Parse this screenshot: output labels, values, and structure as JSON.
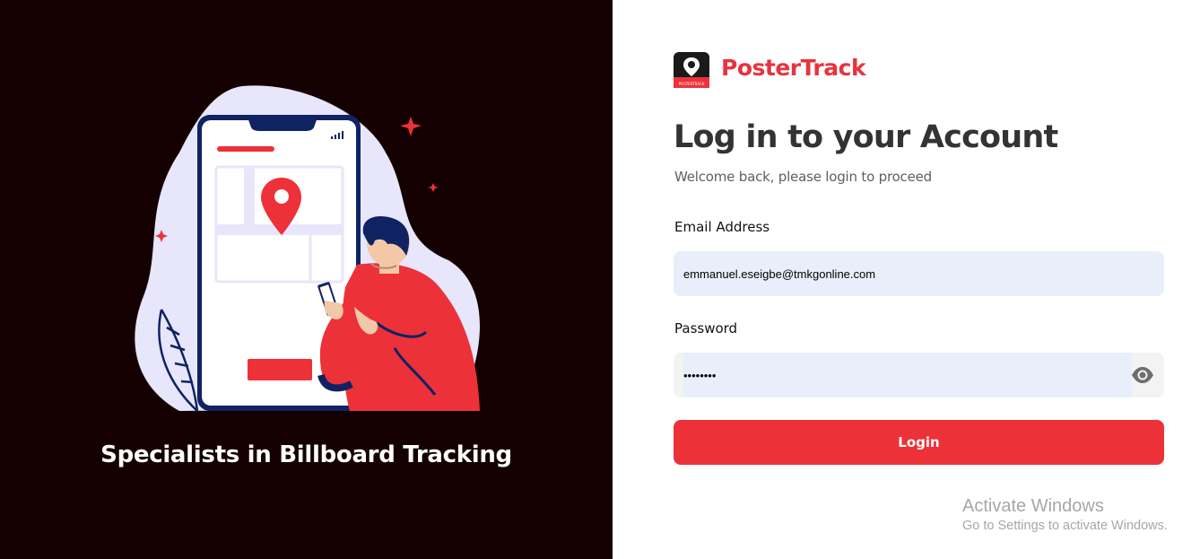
{
  "left": {
    "tagline": "Specialists in Billboard Tracking"
  },
  "brand": {
    "name": "PosterTrack",
    "logo_text": "POSTERTRACK",
    "color": "#e8333d"
  },
  "form": {
    "heading": "Log in to your Account",
    "subtitle": "Welcome back, please login to proceed",
    "email_label": "Email Address",
    "email_value": "emmanuel.eseigbe@tmkgonline.com",
    "password_label": "Password",
    "password_value": "password",
    "login_label": "Login",
    "password_toggle_icon": "eye-icon"
  },
  "watermark": {
    "title": "Activate Windows",
    "subtitle": "Go to Settings to activate Windows."
  },
  "colors": {
    "left_bg": "#150001",
    "accent": "#ed3138",
    "input_bg": "#e8effb",
    "navy": "#0f2362"
  }
}
